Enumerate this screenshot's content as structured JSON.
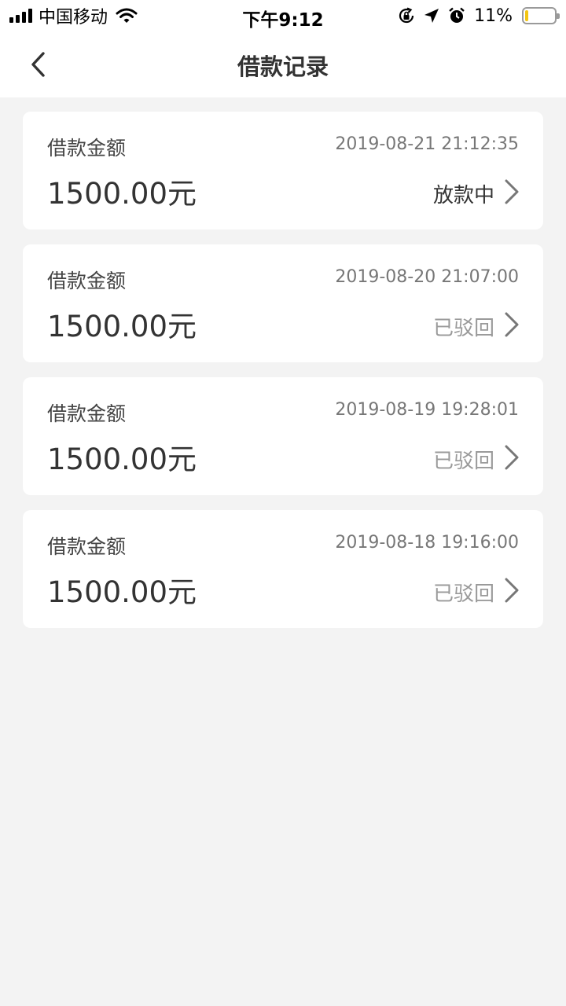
{
  "status_bar": {
    "carrier": "中国移动",
    "time": "下午9:12",
    "battery": "11%",
    "battery_level": 0.11
  },
  "header": {
    "title": "借款记录"
  },
  "records": [
    {
      "label": "借款金额",
      "time": "2019-08-21 21:12:35",
      "amount": "1500.00元",
      "status": "放款中",
      "status_style": "active"
    },
    {
      "label": "借款金额",
      "time": "2019-08-20 21:07:00",
      "amount": "1500.00元",
      "status": "已驳回",
      "status_style": "muted"
    },
    {
      "label": "借款金额",
      "time": "2019-08-19 19:28:01",
      "amount": "1500.00元",
      "status": "已驳回",
      "status_style": "muted"
    },
    {
      "label": "借款金额",
      "time": "2019-08-18 19:16:00",
      "amount": "1500.00元",
      "status": "已驳回",
      "status_style": "muted"
    }
  ],
  "icons": {
    "back": "chevron-left-icon",
    "row_arrow": "chevron-right-icon"
  },
  "colors": {
    "background": "#f3f3f3",
    "card": "#ffffff",
    "status_active": "#333333",
    "status_muted": "#9a9a9a",
    "battery_fill": "#f3c512"
  }
}
